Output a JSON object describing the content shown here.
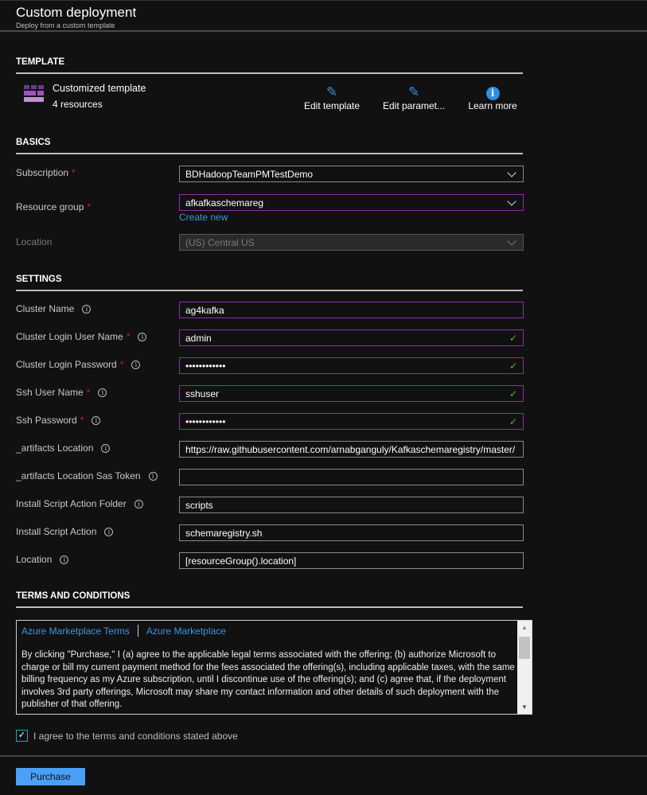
{
  "header": {
    "title": "Custom deployment",
    "subtitle": "Deploy from a custom template"
  },
  "template": {
    "section": "TEMPLATE",
    "name": "Customized template",
    "resources": "4 resources",
    "actions": [
      {
        "label": "Edit template",
        "icon": "pencil-icon"
      },
      {
        "label": "Edit paramet...",
        "icon": "pencil-icon"
      },
      {
        "label": "Learn more",
        "icon": "info-icon"
      }
    ]
  },
  "basics": {
    "section": "BASICS",
    "subscription": {
      "label": "Subscription",
      "value": "BDHadoopTeamPMTestDemo"
    },
    "resource_group": {
      "label": "Resource group",
      "value": "afkafkaschemareg",
      "create_new": "Create new"
    },
    "location": {
      "label": "Location",
      "value": "(US) Central US"
    }
  },
  "settings": {
    "section": "SETTINGS",
    "fields": [
      {
        "label": "Cluster Name",
        "value": "ag4kafka",
        "required": false,
        "valid": false,
        "highlight": true
      },
      {
        "label": "Cluster Login User Name",
        "value": "admin",
        "required": true,
        "valid": true,
        "highlight": true
      },
      {
        "label": "Cluster Login Password",
        "value": "••••••••••••",
        "required": true,
        "valid": true,
        "highlight": true
      },
      {
        "label": "Ssh User Name",
        "value": "sshuser",
        "required": true,
        "valid": true,
        "highlight": true
      },
      {
        "label": "Ssh Password",
        "value": "••••••••••••",
        "required": true,
        "valid": true,
        "highlight": true
      },
      {
        "label": "_artifacts Location",
        "value": "https://raw.githubusercontent.com/arnabganguly/Kafkaschemaregistry/master/",
        "required": false,
        "valid": false,
        "highlight": false
      },
      {
        "label": "_artifacts Location Sas Token",
        "value": "",
        "required": false,
        "valid": false,
        "highlight": false
      },
      {
        "label": "Install Script Action Folder",
        "value": "scripts",
        "required": false,
        "valid": false,
        "highlight": false
      },
      {
        "label": "Install Script Action",
        "value": "schemaregistry.sh",
        "required": false,
        "valid": false,
        "highlight": false
      },
      {
        "label": "Location",
        "value": "[resourceGroup().location]",
        "required": false,
        "valid": false,
        "highlight": false
      }
    ]
  },
  "terms": {
    "section": "TERMS AND CONDITIONS",
    "link1": "Azure Marketplace Terms",
    "link2": "Azure Marketplace",
    "text": "By clicking \"Purchase,\" I (a) agree to the applicable legal terms associated with the offering; (b) authorize Microsoft to charge or bill my current payment method for the fees associated the offering(s), including applicable taxes, with the same billing frequency as my Azure subscription, until I discontinue use of the offering(s); and (c) agree that, if the deployment involves 3rd party offerings, Microsoft may share my contact information and other details of such deployment with the publisher of that offering.",
    "agree": "I agree to the terms and conditions stated above",
    "agreed": true
  },
  "footer": {
    "purchase": "Purchase"
  },
  "colors": {
    "accent": "#4aa0f5",
    "valid_border": "#8b2fa8",
    "link": "#3a96dd",
    "required": "#e81123"
  }
}
